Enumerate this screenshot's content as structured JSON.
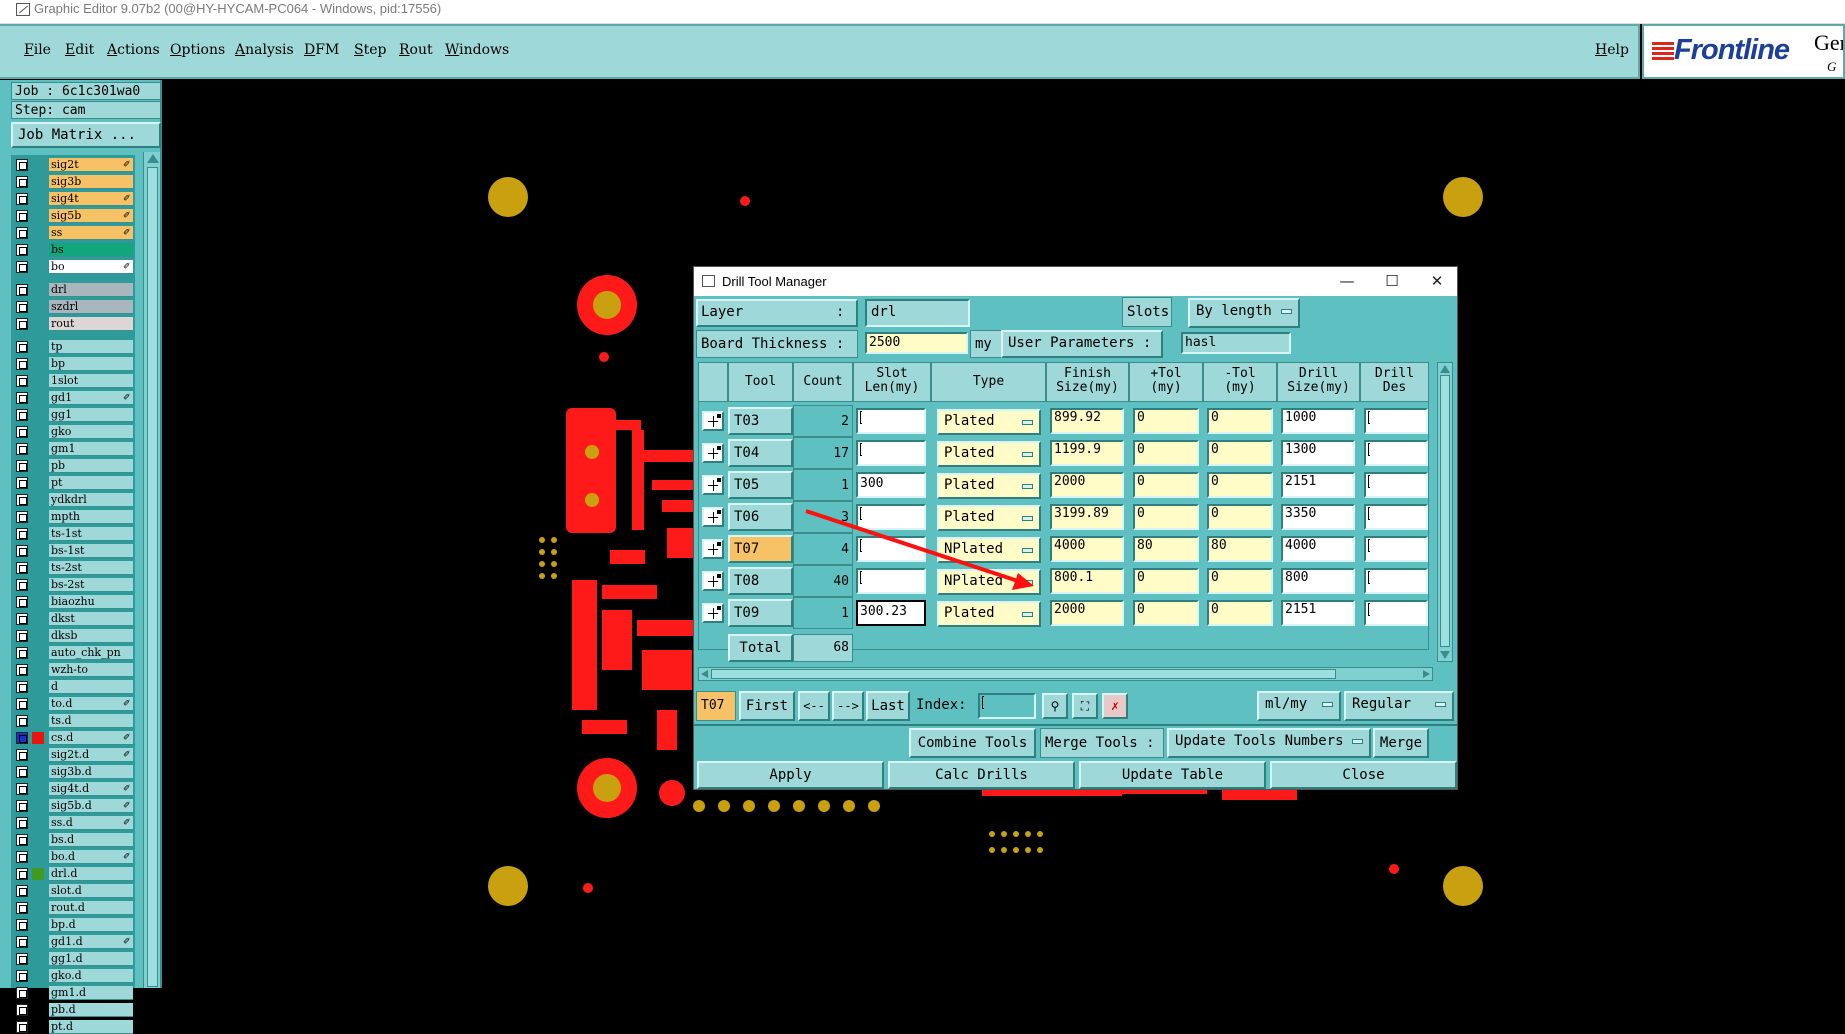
{
  "window": {
    "title": "Graphic Editor 9.07b2 (00@HY-HYCAM-PC064 - Windows, pid:17556)"
  },
  "menu": {
    "items": [
      "File",
      "Edit",
      "Actions",
      "Options",
      "Analysis",
      "DFM",
      "Step",
      "Rout",
      "Windows"
    ],
    "help": "Help"
  },
  "logo": {
    "text": "Frontline",
    "gen": "Ger",
    "sub": "G"
  },
  "left": {
    "job": "Job : 6c1c301wa0",
    "step": "Step: cam",
    "matrix_button": "Job Matrix ...",
    "layers": [
      {
        "name": "sig2t",
        "color": "#f7c266",
        "mark": "✐"
      },
      {
        "name": "sig3b",
        "color": "#f7c266",
        "mark": ""
      },
      {
        "name": "sig4t",
        "color": "#f7c266",
        "mark": "✐"
      },
      {
        "name": "sig5b",
        "color": "#f7c266",
        "mark": "✐"
      },
      {
        "name": "ss",
        "color": "#f7c266",
        "mark": "✐"
      },
      {
        "name": "bs",
        "color": "#11a67c",
        "mark": ""
      },
      {
        "name": "bo",
        "color": "#ffffff",
        "mark": "✐"
      },
      {
        "name": "drl",
        "color": "#aab6bd",
        "mark": ""
      },
      {
        "name": "szdrl",
        "color": "#aab6bd",
        "mark": ""
      },
      {
        "name": "rout",
        "color": "#ddd6d6",
        "mark": ""
      },
      {
        "name": "tp",
        "color": "#9ed8d8",
        "mark": ""
      },
      {
        "name": "bp",
        "color": "#9ed8d8",
        "mark": ""
      },
      {
        "name": "1slot",
        "color": "#9ed8d8",
        "mark": ""
      },
      {
        "name": "gd1",
        "color": "#9ed8d8",
        "mark": "✐"
      },
      {
        "name": "gg1",
        "color": "#9ed8d8",
        "mark": ""
      },
      {
        "name": "gko",
        "color": "#9ed8d8",
        "mark": ""
      },
      {
        "name": "gm1",
        "color": "#9ed8d8",
        "mark": ""
      },
      {
        "name": "pb",
        "color": "#9ed8d8",
        "mark": ""
      },
      {
        "name": "pt",
        "color": "#9ed8d8",
        "mark": ""
      },
      {
        "name": "ydkdrl",
        "color": "#9ed8d8",
        "mark": ""
      },
      {
        "name": "mpth",
        "color": "#9ed8d8",
        "mark": ""
      },
      {
        "name": "ts-1st",
        "color": "#9ed8d8",
        "mark": ""
      },
      {
        "name": "bs-1st",
        "color": "#9ed8d8",
        "mark": ""
      },
      {
        "name": "ts-2st",
        "color": "#9ed8d8",
        "mark": ""
      },
      {
        "name": "bs-2st",
        "color": "#9ed8d8",
        "mark": ""
      },
      {
        "name": "biaozhu",
        "color": "#9ed8d8",
        "mark": ""
      },
      {
        "name": "dkst",
        "color": "#9ed8d8",
        "mark": ""
      },
      {
        "name": "dksb",
        "color": "#9ed8d8",
        "mark": ""
      },
      {
        "name": "auto_chk_pn",
        "color": "#9ed8d8",
        "mark": ""
      },
      {
        "name": "wzh-to",
        "color": "#9ed8d8",
        "mark": ""
      },
      {
        "name": "d",
        "color": "#9ed8d8",
        "mark": ""
      },
      {
        "name": "to.d",
        "color": "#9ed8d8",
        "mark": "✐"
      },
      {
        "name": "ts.d",
        "color": "#9ed8d8",
        "mark": ""
      },
      {
        "name": "cs.d",
        "color": "#9ed8d8",
        "mark": "✐"
      },
      {
        "name": "sig2t.d",
        "color": "#9ed8d8",
        "mark": "✐"
      },
      {
        "name": "sig3b.d",
        "color": "#9ed8d8",
        "mark": ""
      },
      {
        "name": "sig4t.d",
        "color": "#9ed8d8",
        "mark": "✐"
      },
      {
        "name": "sig5b.d",
        "color": "#9ed8d8",
        "mark": "✐"
      },
      {
        "name": "ss.d",
        "color": "#9ed8d8",
        "mark": "✐"
      },
      {
        "name": "bs.d",
        "color": "#9ed8d8",
        "mark": ""
      },
      {
        "name": "bo.d",
        "color": "#9ed8d8",
        "mark": "✐"
      },
      {
        "name": "drl.d",
        "color": "#9ed8d8",
        "mark": ""
      },
      {
        "name": "slot.d",
        "color": "#9ed8d8",
        "mark": ""
      },
      {
        "name": "rout.d",
        "color": "#9ed8d8",
        "mark": ""
      },
      {
        "name": "bp.d",
        "color": "#9ed8d8",
        "mark": ""
      },
      {
        "name": "gd1.d",
        "color": "#9ed8d8",
        "mark": "✐"
      },
      {
        "name": "gg1.d",
        "color": "#9ed8d8",
        "mark": ""
      },
      {
        "name": "gko.d",
        "color": "#9ed8d8",
        "mark": ""
      },
      {
        "name": "gm1.d",
        "color": "#9ed8d8",
        "mark": ""
      },
      {
        "name": "pb.d",
        "color": "#9ed8d8",
        "mark": ""
      },
      {
        "name": "pt.d",
        "color": "#9ed8d8",
        "mark": ""
      }
    ],
    "work_layer_color": "#e8150f",
    "drl_d_color": "#3f9a1f"
  },
  "dialog": {
    "title": "Drill Tool Manager",
    "layer_label": "Layer",
    "layer_colon": ":",
    "layer_value": "drl",
    "slots_label": "Slots:",
    "slots_value": "By length",
    "thickness_label": "Board Thickness :",
    "thickness_value": "2500",
    "thickness_unit": "my",
    "user_params_label": "User Parameters :",
    "user_params_value": "hasl",
    "headers": {
      "tool": "Tool",
      "count": "Count",
      "slot1": "Slot",
      "slot2": "Len(my)",
      "type": "Type",
      "finish1": "Finish",
      "finish2": "Size(my)",
      "ptol1": "+Tol",
      "ptol2": "(my)",
      "mtol1": "-Tol",
      "mtol2": "(my)",
      "drill1": "Drill",
      "drill2": "Size(my)",
      "des1": "Drill",
      "des2": "Des"
    },
    "rows": [
      {
        "tool": "T03",
        "count": "2",
        "slot": "",
        "type": "Plated",
        "finish": "899.92",
        "ptol": "0",
        "mtol": "0",
        "drill": "1000",
        "des": ""
      },
      {
        "tool": "T04",
        "count": "17",
        "slot": "",
        "type": "Plated",
        "finish": "1199.9",
        "ptol": "0",
        "mtol": "0",
        "drill": "1300",
        "des": ""
      },
      {
        "tool": "T05",
        "count": "1",
        "slot": "300",
        "type": "Plated",
        "finish": "2000",
        "ptol": "0",
        "mtol": "0",
        "drill": "2151",
        "des": ""
      },
      {
        "tool": "T06",
        "count": "3",
        "slot": "",
        "type": "Plated",
        "finish": "3199.89",
        "ptol": "0",
        "mtol": "0",
        "drill": "3350",
        "des": ""
      },
      {
        "tool": "T07",
        "count": "4",
        "slot": "",
        "type": "NPlated",
        "finish": "4000",
        "ptol": "80",
        "mtol": "80",
        "drill": "4000",
        "des": ""
      },
      {
        "tool": "T08",
        "count": "40",
        "slot": "",
        "type": "NPlated",
        "finish": "800.1",
        "ptol": "0",
        "mtol": "0",
        "drill": "800",
        "des": ""
      },
      {
        "tool": "T09",
        "count": "1",
        "slot": "300.23",
        "type": "Plated",
        "finish": "2000",
        "ptol": "0",
        "mtol": "0",
        "drill": "2151",
        "des": ""
      }
    ],
    "selected_tool": "T07",
    "total_label": "Total",
    "total_value": "68",
    "nav": {
      "current": "T07",
      "first": "First",
      "prev": "<--",
      "next": "-->",
      "last": "Last",
      "index_label": "Index:",
      "units": "ml/my",
      "mode": "Regular"
    },
    "combine": "Combine Tools",
    "merge_label": "Merge Tools :",
    "merge_option": "Update Tools Numbers",
    "merge_button": "Merge",
    "apply": "Apply",
    "calc": "Calc Drills",
    "update": "Update Table",
    "close": "Close"
  },
  "colors": {
    "panel": "#5ec0c0",
    "panel_light": "#9ed8d8",
    "input_yellow": "#fffcc8",
    "selected": "#f7c266",
    "copper_red": "#ff1a1a",
    "drill_gold": "#c8a010"
  }
}
